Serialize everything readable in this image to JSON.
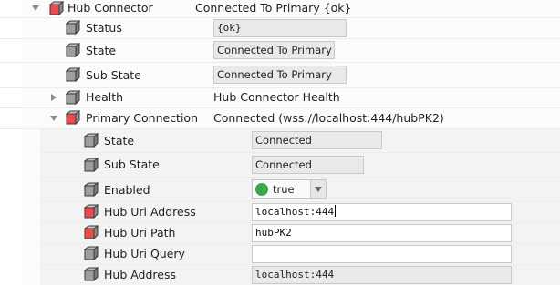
{
  "colors": {
    "red_cube": "#ef4b4b",
    "grey_cube": "#8a8a8a",
    "green_status": "#3aa64a",
    "field_bg": "#e9e9e9"
  },
  "hub_connector": {
    "label": "Hub Connector",
    "value": "Connected To Primary {ok}",
    "icon": "red-cube-icon",
    "expanded": true
  },
  "status": {
    "label": "Status",
    "value": "{ok}",
    "icon": "grey-cube-icon"
  },
  "state": {
    "label": "State",
    "value": "Connected To Primary",
    "icon": "grey-cube-icon"
  },
  "sub_state": {
    "label": "Sub State",
    "value": "Connected To Primary",
    "icon": "grey-cube-icon"
  },
  "health": {
    "label": "Health",
    "value": "Hub Connector Health",
    "icon": "grey-cube-icon",
    "expanded": false
  },
  "primary_connection": {
    "label": "Primary Connection",
    "value": "Connected (wss://localhost:444/hubPK2)",
    "icon": "red-cube-icon",
    "expanded": true
  },
  "pc_state": {
    "label": "State",
    "value": "Connected",
    "icon": "grey-cube-icon"
  },
  "pc_sub_state": {
    "label": "Sub State",
    "value": "Connected",
    "icon": "grey-cube-icon"
  },
  "pc_enabled": {
    "label": "Enabled",
    "value": "true",
    "icon": "grey-cube-icon"
  },
  "hub_uri_address": {
    "label": "Hub Uri Address",
    "value": "localhost:444",
    "icon": "red-cube-icon"
  },
  "hub_uri_path": {
    "label": "Hub Uri Path",
    "value": "hubPK2",
    "icon": "red-cube-icon"
  },
  "hub_uri_query": {
    "label": "Hub Uri Query",
    "value": "",
    "icon": "grey-cube-icon"
  },
  "hub_address": {
    "label": "Hub Address",
    "value": "localhost:444",
    "icon": "grey-cube-icon"
  }
}
